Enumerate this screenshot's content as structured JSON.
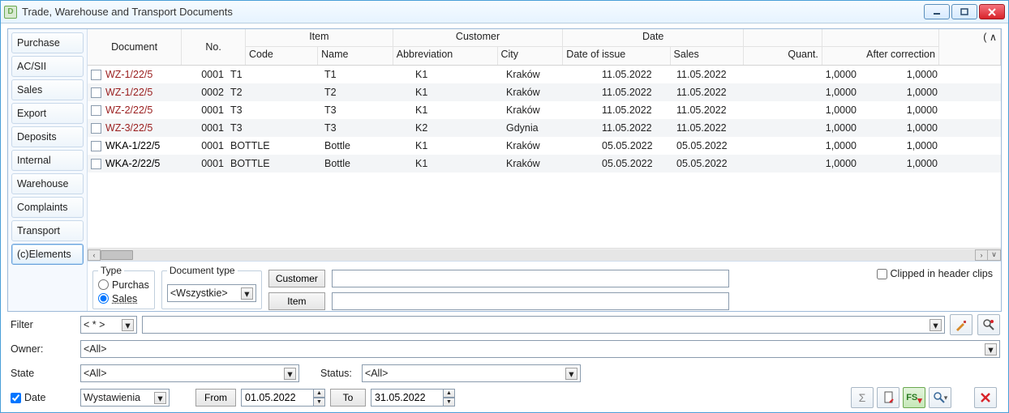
{
  "title": "Trade, Warehouse and Transport Documents",
  "sidebar": {
    "items": [
      {
        "label": "Purchase"
      },
      {
        "label": "AC/SII"
      },
      {
        "label": "Sales"
      },
      {
        "label": "Export"
      },
      {
        "label": "Deposits"
      },
      {
        "label": "Internal"
      },
      {
        "label": "Warehouse"
      },
      {
        "label": "Complaints"
      },
      {
        "label": "Transport"
      },
      {
        "label": "(c)Elements"
      }
    ],
    "active_index": 9
  },
  "grid": {
    "headers": {
      "document": "Document",
      "no": "No.",
      "item": "Item",
      "code": "Code",
      "name": "Name",
      "customer": "Customer",
      "abbrev": "Abbreviation",
      "city": "City",
      "date": "Date",
      "date_of_issue": "Date of issue",
      "sales": "Sales",
      "quant": "Quant.",
      "after_corr": "﻿After correction",
      "paren": "( ∧"
    },
    "rows": [
      {
        "doc": "WZ-1/22/5",
        "red": true,
        "no": "0001",
        "code": "T1",
        "name": "T1",
        "abbrev": "K1",
        "city": "Kraków",
        "issue": "11.05.2022",
        "sales": "11.05.2022",
        "quant": "1,0000",
        "after": "1,0000"
      },
      {
        "doc": "WZ-1/22/5",
        "red": true,
        "no": "0002",
        "code": "T2",
        "name": "T2",
        "abbrev": "K1",
        "city": "Kraków",
        "issue": "11.05.2022",
        "sales": "11.05.2022",
        "quant": "1,0000",
        "after": "1,0000"
      },
      {
        "doc": "WZ-2/22/5",
        "red": true,
        "no": "0001",
        "code": "T3",
        "name": "T3",
        "abbrev": "K1",
        "city": "Kraków",
        "issue": "11.05.2022",
        "sales": "11.05.2022",
        "quant": "1,0000",
        "after": "1,0000"
      },
      {
        "doc": "WZ-3/22/5",
        "red": true,
        "no": "0001",
        "code": "T3",
        "name": "T3",
        "abbrev": "K2",
        "city": "Gdynia",
        "issue": "11.05.2022",
        "sales": "11.05.2022",
        "quant": "1,0000",
        "after": "1,0000"
      },
      {
        "doc": "WKA-1/22/5",
        "red": false,
        "no": "0001",
        "code": "BOTTLE",
        "name": "Bottle",
        "abbrev": "K1",
        "city": "Kraków",
        "issue": "05.05.2022",
        "sales": "05.05.2022",
        "quant": "1,0000",
        "after": "1,0000"
      },
      {
        "doc": "WKA-2/22/5",
        "red": false,
        "no": "0001",
        "code": "BOTTLE",
        "name": "Bottle",
        "abbrev": "K1",
        "city": "Kraków",
        "issue": "05.05.2022",
        "sales": "05.05.2022",
        "quant": "1,0000",
        "after": "1,0000"
      }
    ]
  },
  "filters": {
    "type_label": "Type",
    "type_purchase": "Purchas",
    "type_sales": "Sales",
    "doctype_label": "Document type",
    "doctype_value": "<Wszystkie>",
    "customer_btn": "Customer",
    "item_btn": "Item",
    "clipped_label": "Clipped in header clips"
  },
  "lower": {
    "filter_label": "Filter",
    "filter_op": "< * >",
    "owner_label": "Owner:",
    "owner_value": "<All>",
    "state_label": "State",
    "state_value": "<All>",
    "status_label": "Status:",
    "status_value": "<All>",
    "date_label": "Date",
    "date_combo": "Wystawienia",
    "from_btn": "From",
    "from_value": "01.05.2022",
    "to_btn": "To",
    "to_value": "31.05.2022"
  }
}
